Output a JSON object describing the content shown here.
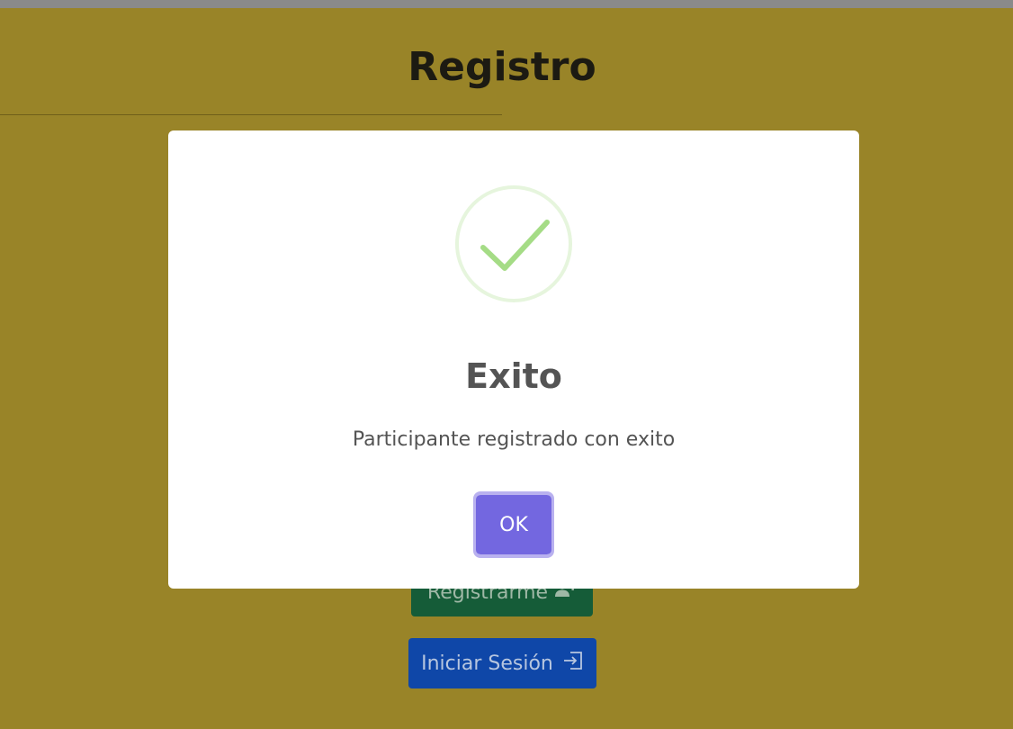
{
  "page": {
    "title": "Registro",
    "background_color": "#998428"
  },
  "buttons": {
    "register_label": "Registrarme",
    "register_icon": "user-plus-icon",
    "login_label": "Iniciar Sesión",
    "login_icon": "box-arrow-in-right-icon"
  },
  "modal": {
    "icon": "success-check-icon",
    "title": "Exito",
    "message": "Participante registrado con exito",
    "confirm_label": "OK",
    "confirm_color": "#7367e0",
    "icon_color": "#a5dc86"
  }
}
